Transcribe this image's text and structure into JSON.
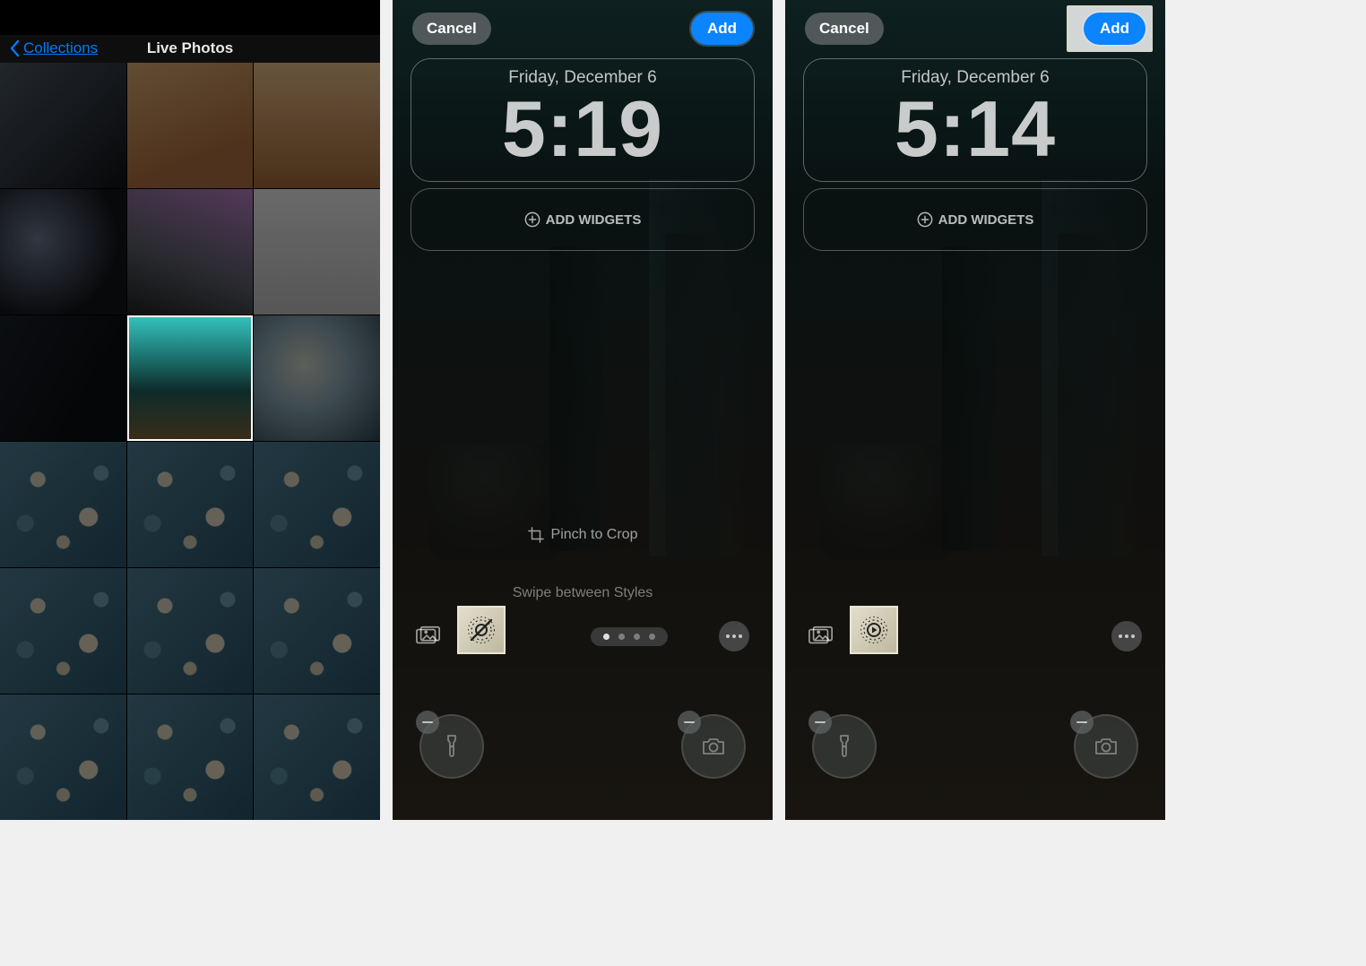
{
  "screen1": {
    "back_label": "Collections",
    "title": "Live Photos"
  },
  "screen2": {
    "cancel": "Cancel",
    "add": "Add",
    "date": "Friday, December 6",
    "time": "5:19",
    "widgets_label": "ADD WIDGETS",
    "pinch_label": "Pinch to Crop",
    "swipe_label": "Swipe between Styles"
  },
  "screen3": {
    "cancel": "Cancel",
    "add": "Add",
    "date": "Friday, December 6",
    "time": "5:14",
    "widgets_label": "ADD WIDGETS"
  }
}
